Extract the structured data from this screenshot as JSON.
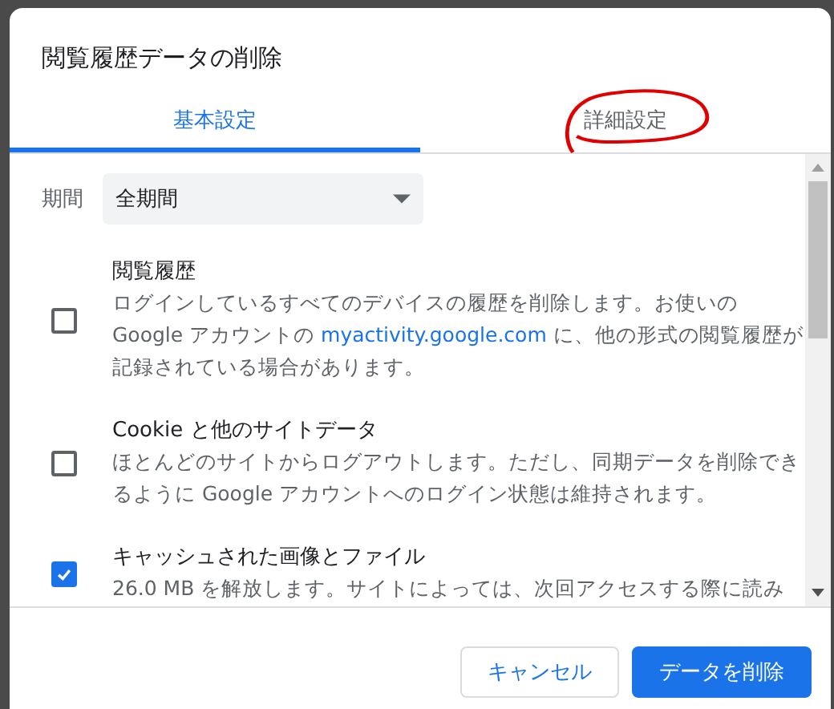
{
  "dialog": {
    "title": "閲覧履歴データの削除"
  },
  "tabs": [
    {
      "label": "基本設定",
      "selected": true,
      "circled": false
    },
    {
      "label": "詳細設定",
      "selected": false,
      "circled": true
    }
  ],
  "time_range": {
    "label": "期間",
    "value": "全期間"
  },
  "options": [
    {
      "title": "閲覧履歴",
      "checked": false,
      "description_before": "ログインしているすべてのデバイスの履歴を削除します。お使いの Google アカウントの ",
      "link": "myactivity.google.com",
      "description_after": " に、他の形式の閲覧履歴が記録されている場合があります。"
    },
    {
      "title": "Cookie と他のサイトデータ",
      "checked": false,
      "description_before": "ほとんどのサイトからログアウトします。ただし、同期データを削除できるように Google アカウントへのログイン状態は維持されます。"
    },
    {
      "title": "キャッシュされた画像とファイル",
      "checked": true,
      "description_before": "26.0 MB を解放します。サイトによっては、次回アクセスする際に読み"
    }
  ],
  "buttons": [
    {
      "label": "キャンセル",
      "kind": "secondary"
    },
    {
      "label": "データを削除",
      "kind": "primary"
    }
  ]
}
